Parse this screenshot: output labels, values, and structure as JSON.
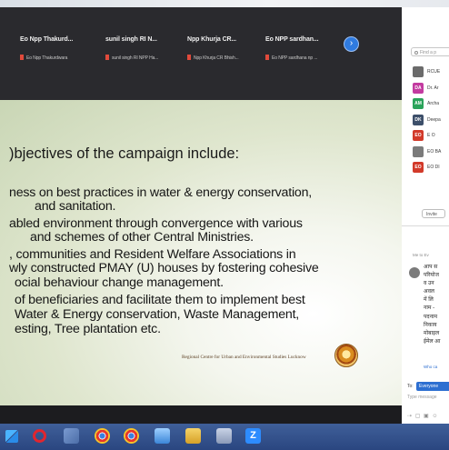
{
  "participants": [
    {
      "name": "Eo Npp Thakurd...",
      "sub": "Eo Npp Thakurdwara"
    },
    {
      "name": "sunil singh RI N...",
      "sub": "sunil singh RI NPP Ha..."
    },
    {
      "name": "Npp Khurja CR...",
      "sub": "Npp Khurja CR Bhish..."
    },
    {
      "name": "Eo NPP sardhan...",
      "sub": "Eo NPP sardhana np ..."
    }
  ],
  "next_page_icon": "chevron-right-icon",
  "slide": {
    "title": ")bjectives of the campaign include:",
    "lines": [
      "ness on best practices in water & energy conservation,",
      "and sanitation.",
      "abled environment through convergence with various",
      "and schemes of other Central Ministries.",
      ", communities and Resident Welfare Associations in",
      "wly constructed PMAY (U) houses by fostering cohesive",
      "ocial behaviour change management.",
      "of beneficiaries and facilitate them to implement best",
      "Water & Energy conservation, Waste Management,",
      "esting, Tree plantation etc."
    ],
    "footer": "Regional Centre for Urban and Environmental Studies Lucknow"
  },
  "side_panel": {
    "search_placeholder": "Find a p",
    "participants": [
      {
        "initials": "",
        "label": "RCUE",
        "color": "#6b6b6b"
      },
      {
        "initials": "DA",
        "label": "Dr. Ar",
        "color": "#c33ba0"
      },
      {
        "initials": "AM",
        "label": "Archa",
        "color": "#2aa35a"
      },
      {
        "initials": "DK",
        "label": "Deepa",
        "color": "#3d4f6a"
      },
      {
        "initials": "EO",
        "label": "E O",
        "color": "#d23a2a"
      },
      {
        "initials": "",
        "label": "EO BA",
        "color": "#7b7b7b"
      },
      {
        "initials": "EO",
        "label": "EO DI",
        "color": "#d23a2a"
      }
    ],
    "pill_label": "Invite",
    "chat_from": "Me to Ev",
    "chat_lines": [
      "आप स",
      "परियोज",
      "व उन",
      "अवल",
      "में लि",
      "नाम -",
      "पदनाम",
      "निकाय",
      "मोबाइल",
      "ईमेल आ"
    ],
    "chat_more": "Who ca",
    "to_label": "To:",
    "to_value": "Everyone",
    "type_placeholder": "Type message",
    "tools": "⇢ ▢ ▣ ☺"
  },
  "taskbar_icons": [
    "start-icon",
    "opera-icon",
    "chrome-icon",
    "file-explorer-icon",
    "zoom-icon"
  ]
}
